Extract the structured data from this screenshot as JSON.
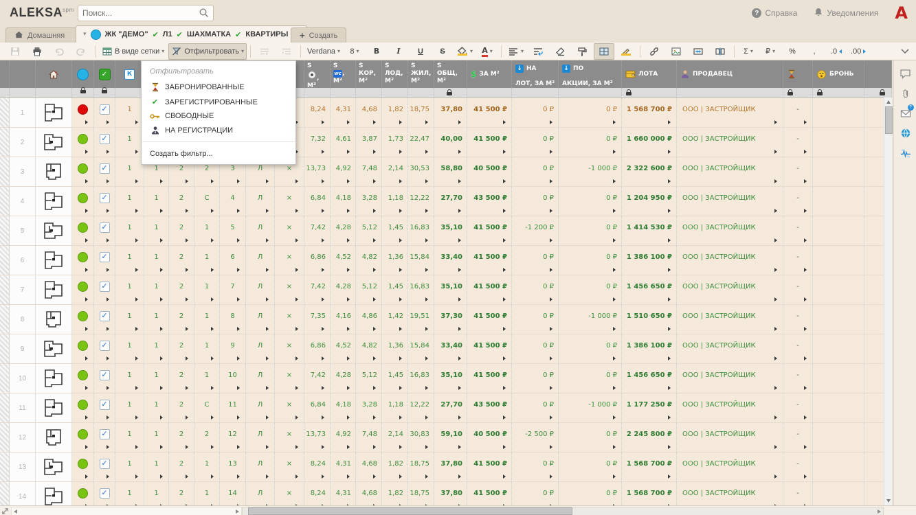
{
  "topbar": {
    "logo": "ALEKSA",
    "logo_sup": "spm",
    "search_placeholder": "Поиск...",
    "help_label": "Справка",
    "notifications_label": "Уведомления",
    "brand_letter": "А"
  },
  "tabs": {
    "home_label": "Домашняя",
    "active": {
      "title": "ЖК \"ДЕМО\"",
      "segments": [
        "Л1",
        "ШАХМАТКА",
        "КВАРТИРЫ"
      ],
      "close_glyph": "×",
      "caret_glyph": "▾",
      "check_glyph": "✔"
    },
    "create_label": "Создать",
    "create_plus": "+"
  },
  "toolbar": {
    "items": [
      {
        "id": "save",
        "icon": "save-icon",
        "disabled": true
      },
      {
        "id": "print",
        "icon": "print-icon"
      },
      {
        "id": "undo",
        "icon": "undo-icon",
        "disabled": true
      },
      {
        "id": "redo",
        "icon": "redo-icon",
        "disabled": true
      },
      {
        "sep": true
      },
      {
        "id": "view-grid",
        "icon": "grid-icon",
        "label": "В виде сетки",
        "caret": true
      },
      {
        "id": "filter",
        "icon": "filter-icon",
        "label": "Отфильтровать",
        "caret": true,
        "pressed": true
      },
      {
        "sep": true
      },
      {
        "id": "row-add",
        "icon": "row-add-icon",
        "disabled": true
      },
      {
        "id": "row-indent",
        "icon": "row-indent-icon",
        "disabled": true
      },
      {
        "sep": true
      },
      {
        "id": "font-family",
        "label": "Verdana",
        "caret": true
      },
      {
        "id": "font-size",
        "label": "8",
        "caret": true
      },
      {
        "id": "bold",
        "label": "B",
        "cls": "glyph"
      },
      {
        "id": "italic",
        "label": "I",
        "cls": "gl-i"
      },
      {
        "id": "underline",
        "label": "U",
        "cls": "gl-u"
      },
      {
        "id": "strike",
        "label": "S",
        "cls": "gl-s"
      },
      {
        "id": "fill-color",
        "icon": "fill-icon",
        "bar": "#f0c030",
        "caret": true
      },
      {
        "id": "font-color",
        "label": "A",
        "cls": "glyph",
        "bar": "#d33a2a",
        "caret": true
      },
      {
        "sep": true
      },
      {
        "id": "align",
        "icon": "align-icon",
        "caret": true
      },
      {
        "id": "wrap",
        "icon": "wrap-icon"
      },
      {
        "id": "clear-format",
        "icon": "eraser-icon"
      },
      {
        "id": "format-painter",
        "icon": "painter-icon"
      },
      {
        "id": "borders",
        "icon": "borders-icon",
        "pressed": true
      },
      {
        "id": "edit-cell",
        "icon": "pencil-icon",
        "bar": "#f0c030"
      },
      {
        "sep": true
      },
      {
        "id": "link",
        "icon": "link-icon"
      },
      {
        "id": "image",
        "icon": "image-icon"
      },
      {
        "id": "merge",
        "icon": "merge-icon"
      },
      {
        "id": "split",
        "icon": "split-icon"
      },
      {
        "sep": true
      },
      {
        "id": "sum",
        "label": "Σ",
        "caret": true
      },
      {
        "id": "currency",
        "label": "₽",
        "caret": true
      },
      {
        "id": "percent",
        "label": "%"
      },
      {
        "id": "comma",
        "label": ","
      },
      {
        "id": "dec-less",
        "label": ".0",
        "arrow": "left"
      },
      {
        "id": "dec-more",
        "label": ".00",
        "arrow": "right"
      }
    ]
  },
  "filter_menu": {
    "title": "Отфильтровать",
    "items": [
      {
        "icon": "hourglass-icon",
        "label": "ЗАБРОНИРОВАННЫЕ"
      },
      {
        "icon": "check-icon",
        "label": "ЗАРЕГИСТРИРОВАННЫЕ",
        "glyph": "✔"
      },
      {
        "icon": "key-icon",
        "label": "СВОБОДНЫЕ"
      },
      {
        "icon": "user-icon",
        "label": "НА РЕГИСТРАЦИИ"
      }
    ],
    "footer": "Создать фильтр..."
  },
  "grid": {
    "icon_texts": {
      "k": "К",
      "wc": "wc",
      "dollar": "$",
      "down": "↓",
      "check": "✓"
    },
    "main_columns": [
      {
        "id": "s-kitchen",
        "prefix": "S",
        "icon": "kitchen-icon",
        "mid": ",",
        "unit": "М²"
      },
      {
        "id": "s-wc",
        "prefix": "S",
        "icon": "wc-icon",
        "mid": ",",
        "unit": "М²"
      },
      {
        "id": "s-kor",
        "prefix": "S",
        "mid": "КОР,",
        "unit": "М²"
      },
      {
        "id": "s-lod",
        "prefix": "S",
        "mid": "ЛОД,",
        "unit": "М²"
      },
      {
        "id": "s-zhil",
        "prefix": "S",
        "mid": "ЖИЛ,",
        "unit": "М²"
      },
      {
        "id": "s-obsh",
        "prefix": "S",
        "mid": "ОБЩ,",
        "unit": "М²",
        "lock": true
      },
      {
        "id": "price-m2",
        "icon": "dollar-icon",
        "label": "ЗА М²"
      },
      {
        "id": "disc-lot",
        "icon": "down-icon",
        "line1": "НА",
        "line2": "ЛОТ, ЗА М²"
      },
      {
        "id": "disc-promo",
        "icon": "down-icon",
        "line1": "ПО",
        "line2": "АКЦИИ, ЗА М²"
      },
      {
        "id": "lot-price",
        "icon": "wallet-icon",
        "label": "ЛОТА",
        "lock": true
      },
      {
        "id": "seller",
        "icon": "seller-icon",
        "label": "ПРОДАВЕЦ"
      },
      {
        "id": "hold",
        "icon": "hourglass-icon",
        "label": "",
        "lock": true
      },
      {
        "id": "bron",
        "icon": "face-icon",
        "label": "БРОНЬ",
        "lock": true
      },
      {
        "id": "extra",
        "label": "",
        "lock": true
      }
    ],
    "rows": [
      {
        "num": "1",
        "status": "red",
        "checked": true,
        "mid": [
          "1",
          "",
          "",
          "",
          "",
          "",
          ""
        ],
        "s": [
          "8,24",
          "4,31",
          "4,68",
          "1,82",
          "18,75",
          "37,80"
        ],
        "price_m2": "41 500 ₽",
        "disc_lot": "0 ₽",
        "disc_promo": "0 ₽",
        "lot_price": "1 568 700 ₽",
        "seller": "ООО | ЗАСТРОЙЩИК",
        "hold": "-"
      },
      {
        "num": "2",
        "status": "green",
        "checked": true,
        "mid": [
          "1",
          "",
          "",
          "",
          "",
          "",
          ""
        ],
        "s": [
          "7,32",
          "4,61",
          "3,87",
          "1,73",
          "22,47",
          "40,00"
        ],
        "price_m2": "41 500 ₽",
        "disc_lot": "0 ₽",
        "disc_promo": "0 ₽",
        "lot_price": "1 660 000 ₽",
        "seller": "ООО | ЗАСТРОЙЩИК",
        "hold": "-"
      },
      {
        "num": "3",
        "status": "green",
        "checked": true,
        "mid": [
          "1",
          "1",
          "2",
          "2",
          "3",
          "Л",
          "×"
        ],
        "s": [
          "13,73",
          "4,92",
          "7,48",
          "2,14",
          "30,53",
          "58,80"
        ],
        "price_m2": "40 500 ₽",
        "disc_lot": "0 ₽",
        "disc_promo": "-1 000 ₽",
        "lot_price": "2 322 600 ₽",
        "seller": "ООО | ЗАСТРОЙЩИК",
        "hold": "-"
      },
      {
        "num": "4",
        "status": "green",
        "checked": true,
        "mid": [
          "1",
          "1",
          "2",
          "С",
          "4",
          "Л",
          "×"
        ],
        "s": [
          "6,84",
          "4,18",
          "3,28",
          "1,18",
          "12,22",
          "27,70"
        ],
        "price_m2": "43 500 ₽",
        "disc_lot": "0 ₽",
        "disc_promo": "0 ₽",
        "lot_price": "1 204 950 ₽",
        "seller": "ООО | ЗАСТРОЙЩИК",
        "hold": "-"
      },
      {
        "num": "5",
        "status": "green",
        "checked": true,
        "mid": [
          "1",
          "1",
          "2",
          "1",
          "5",
          "Л",
          "×"
        ],
        "s": [
          "7,42",
          "4,28",
          "5,12",
          "1,45",
          "16,83",
          "35,10"
        ],
        "price_m2": "41 500 ₽",
        "disc_lot": "-1 200 ₽",
        "disc_promo": "0 ₽",
        "lot_price": "1 414 530 ₽",
        "seller": "ООО | ЗАСТРОЙЩИК",
        "hold": "-"
      },
      {
        "num": "6",
        "status": "green",
        "checked": true,
        "mid": [
          "1",
          "1",
          "2",
          "1",
          "6",
          "Л",
          "×"
        ],
        "s": [
          "6,86",
          "4,52",
          "4,82",
          "1,36",
          "15,84",
          "33,40"
        ],
        "price_m2": "41 500 ₽",
        "disc_lot": "0 ₽",
        "disc_promo": "0 ₽",
        "lot_price": "1 386 100 ₽",
        "seller": "ООО | ЗАСТРОЙЩИК",
        "hold": "-"
      },
      {
        "num": "7",
        "status": "green",
        "checked": true,
        "mid": [
          "1",
          "1",
          "2",
          "1",
          "7",
          "Л",
          "×"
        ],
        "s": [
          "7,42",
          "4,28",
          "5,12",
          "1,45",
          "16,83",
          "35,10"
        ],
        "price_m2": "41 500 ₽",
        "disc_lot": "0 ₽",
        "disc_promo": "0 ₽",
        "lot_price": "1 456 650 ₽",
        "seller": "ООО | ЗАСТРОЙЩИК",
        "hold": "-"
      },
      {
        "num": "8",
        "status": "green",
        "checked": true,
        "mid": [
          "1",
          "1",
          "2",
          "1",
          "8",
          "Л",
          "×"
        ],
        "s": [
          "7,35",
          "4,16",
          "4,86",
          "1,42",
          "19,51",
          "37,30"
        ],
        "price_m2": "41 500 ₽",
        "disc_lot": "0 ₽",
        "disc_promo": "-1 000 ₽",
        "lot_price": "1 510 650 ₽",
        "seller": "ООО | ЗАСТРОЙЩИК",
        "hold": "-"
      },
      {
        "num": "9",
        "status": "green",
        "checked": true,
        "mid": [
          "1",
          "1",
          "2",
          "1",
          "9",
          "Л",
          "×"
        ],
        "s": [
          "6,86",
          "4,52",
          "4,82",
          "1,36",
          "15,84",
          "33,40"
        ],
        "price_m2": "41 500 ₽",
        "disc_lot": "0 ₽",
        "disc_promo": "0 ₽",
        "lot_price": "1 386 100 ₽",
        "seller": "ООО | ЗАСТРОЙЩИК",
        "hold": "-"
      },
      {
        "num": "10",
        "status": "green",
        "checked": true,
        "mid": [
          "1",
          "1",
          "2",
          "1",
          "10",
          "Л",
          "×"
        ],
        "s": [
          "7,42",
          "4,28",
          "5,12",
          "1,45",
          "16,83",
          "35,10"
        ],
        "price_m2": "41 500 ₽",
        "disc_lot": "0 ₽",
        "disc_promo": "0 ₽",
        "lot_price": "1 456 650 ₽",
        "seller": "ООО | ЗАСТРОЙЩИК",
        "hold": "-"
      },
      {
        "num": "11",
        "status": "green",
        "checked": true,
        "mid": [
          "1",
          "1",
          "2",
          "С",
          "11",
          "Л",
          "×"
        ],
        "s": [
          "6,84",
          "4,18",
          "3,28",
          "1,18",
          "12,22",
          "27,70"
        ],
        "price_m2": "43 500 ₽",
        "disc_lot": "0 ₽",
        "disc_promo": "-1 000 ₽",
        "lot_price": "1 177 250 ₽",
        "seller": "ООО | ЗАСТРОЙЩИК",
        "hold": "-"
      },
      {
        "num": "12",
        "status": "green",
        "checked": true,
        "mid": [
          "1",
          "1",
          "2",
          "2",
          "12",
          "Л",
          "×"
        ],
        "s": [
          "13,73",
          "4,92",
          "7,48",
          "2,14",
          "30,83",
          "59,10"
        ],
        "price_m2": "40 500 ₽",
        "disc_lot": "-2 500 ₽",
        "disc_promo": "0 ₽",
        "lot_price": "2 245 800 ₽",
        "seller": "ООО | ЗАСТРОЙЩИК",
        "hold": "-"
      },
      {
        "num": "13",
        "status": "green",
        "checked": true,
        "mid": [
          "1",
          "1",
          "2",
          "1",
          "13",
          "Л",
          "×"
        ],
        "s": [
          "8,24",
          "4,31",
          "4,68",
          "1,82",
          "18,75",
          "37,80"
        ],
        "price_m2": "41 500 ₽",
        "disc_lot": "0 ₽",
        "disc_promo": "0 ₽",
        "lot_price": "1 568 700 ₽",
        "seller": "ООО | ЗАСТРОЙЩИК",
        "hold": "-"
      },
      {
        "num": "14",
        "status": "green",
        "checked": true,
        "mid": [
          "1",
          "1",
          "2",
          "1",
          "14",
          "Л",
          "×"
        ],
        "s": [
          "8,24",
          "4,31",
          "4,68",
          "1,82",
          "18,75",
          "37,80"
        ],
        "price_m2": "41 500 ₽",
        "disc_lot": "0 ₽",
        "disc_promo": "0 ₽",
        "lot_price": "1 568 700 ₽",
        "seller": "ООО | ЗАСТРОЙЩИК",
        "hold": "-"
      }
    ]
  },
  "sidebar": {
    "icons": [
      "comment-icon",
      "paperclip-icon",
      "mail-icon",
      "globe-icon",
      "activity-icon"
    ]
  }
}
